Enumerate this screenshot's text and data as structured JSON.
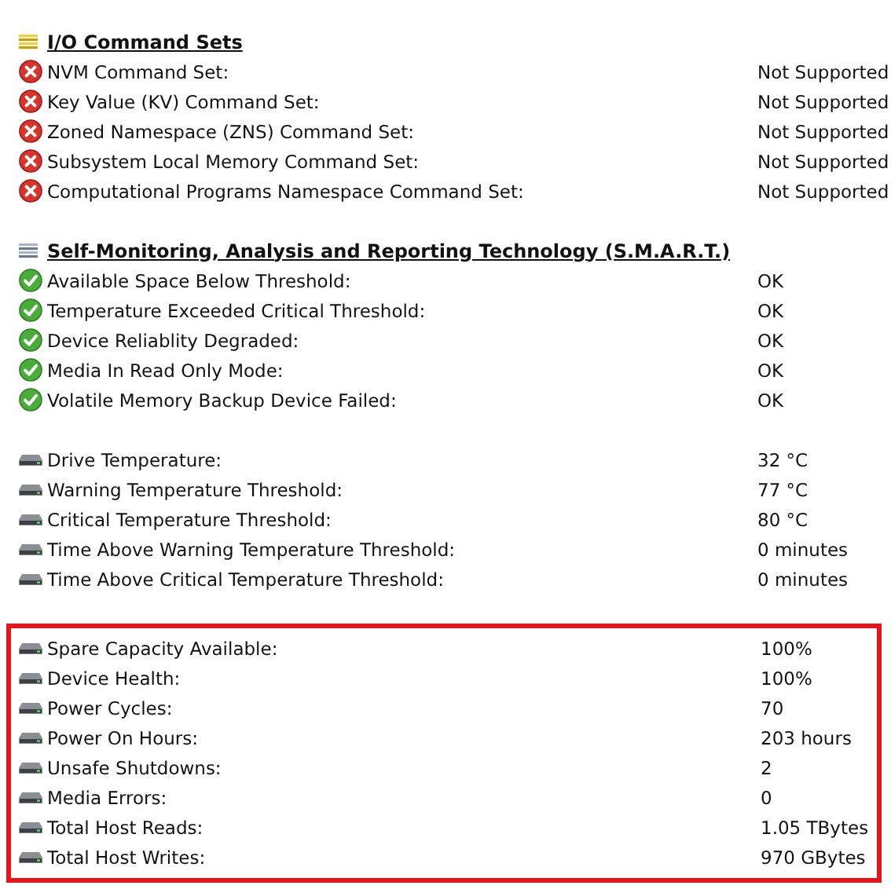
{
  "groups": [
    {
      "heading": {
        "text": "I/O Command Sets",
        "kind": "gold"
      },
      "highlighted": false,
      "rows": [
        {
          "kind": "error",
          "label": "NVM Command Set:",
          "value": "Not Supported"
        },
        {
          "kind": "error",
          "label": "Key Value (KV) Command Set:",
          "value": "Not Supported"
        },
        {
          "kind": "error",
          "label": "Zoned Namespace (ZNS) Command Set:",
          "value": "Not Supported"
        },
        {
          "kind": "error",
          "label": "Subsystem Local Memory Command Set:",
          "value": "Not Supported"
        },
        {
          "kind": "error",
          "label": "Computational Programs Namespace Command Set:",
          "value": "Not Supported"
        }
      ]
    },
    {
      "heading": {
        "text": "Self-Monitoring, Analysis and Reporting Technology (S.M.A.R.T.)",
        "kind": "slate"
      },
      "highlighted": false,
      "rows": [
        {
          "kind": "ok",
          "label": "Available Space Below Threshold:",
          "value": "OK"
        },
        {
          "kind": "ok",
          "label": "Temperature Exceeded Critical Threshold:",
          "value": "OK"
        },
        {
          "kind": "ok",
          "label": "Device Reliablity Degraded:",
          "value": "OK"
        },
        {
          "kind": "ok",
          "label": "Media In Read Only Mode:",
          "value": "OK"
        },
        {
          "kind": "ok",
          "label": "Volatile Memory Backup Device Failed:",
          "value": "OK"
        }
      ]
    },
    {
      "highlighted": false,
      "rows": [
        {
          "kind": "drive",
          "label": "Drive Temperature:",
          "value": "32 °C"
        },
        {
          "kind": "drive",
          "label": "Warning Temperature Threshold:",
          "value": "77 °C"
        },
        {
          "kind": "drive",
          "label": "Critical Temperature Threshold:",
          "value": "80 °C"
        },
        {
          "kind": "drive",
          "label": "Time Above Warning Temperature Threshold:",
          "value": "0 minutes"
        },
        {
          "kind": "drive",
          "label": "Time Above Critical Temperature Threshold:",
          "value": "0 minutes"
        }
      ]
    },
    {
      "highlighted": true,
      "rows": [
        {
          "kind": "drive",
          "label": "Spare Capacity Available:",
          "value": "100%"
        },
        {
          "kind": "drive",
          "label": "Device Health:",
          "value": "100%"
        },
        {
          "kind": "drive",
          "label": "Power Cycles:",
          "value": "70"
        },
        {
          "kind": "drive",
          "label": "Power On Hours:",
          "value": "203 hours"
        },
        {
          "kind": "drive",
          "label": "Unsafe Shutdowns:",
          "value": "2"
        },
        {
          "kind": "drive",
          "label": "Media Errors:",
          "value": "0"
        },
        {
          "kind": "drive",
          "label": "Total Host Reads:",
          "value": "1.05 TBytes"
        },
        {
          "kind": "drive",
          "label": "Total Host Writes:",
          "value": "970 GBytes"
        }
      ]
    }
  ]
}
